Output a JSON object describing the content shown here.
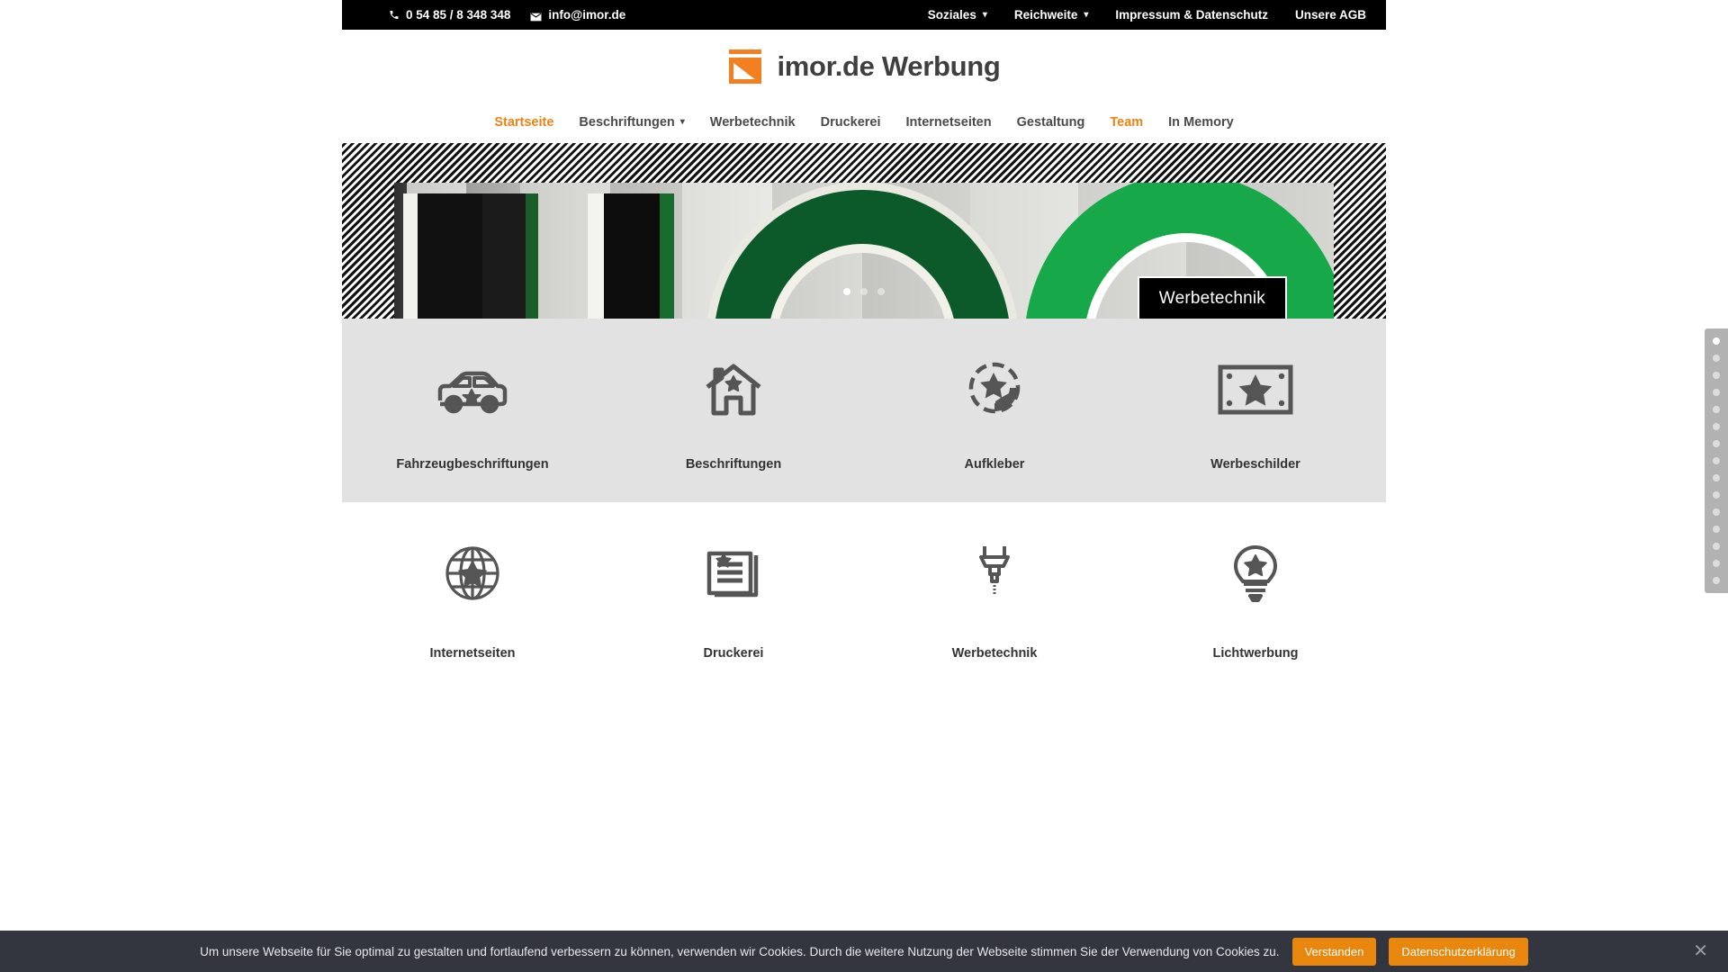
{
  "topbar": {
    "phone": "0 54 85 / 8 348 348",
    "email": "info@imor.de",
    "phone_icon": "phone-icon",
    "mail_icon": "mail-icon",
    "menu": [
      {
        "label": "Soziales",
        "has_dropdown": true
      },
      {
        "label": "Reichweite",
        "has_dropdown": true
      },
      {
        "label": "Impressum & Datenschutz",
        "has_dropdown": false
      },
      {
        "label": "Unsere AGB",
        "has_dropdown": false
      }
    ]
  },
  "brand": {
    "name": "imor.de Werbung",
    "mark_icon": "imor-logo-mark",
    "mark_color": "#f28020",
    "text_color": "#3f3f3f"
  },
  "mainnav": {
    "items": [
      {
        "label": "Startseite",
        "active": true,
        "has_dropdown": false
      },
      {
        "label": "Beschriftungen",
        "active": false,
        "has_dropdown": true
      },
      {
        "label": "Werbetechnik",
        "active": false,
        "has_dropdown": false
      },
      {
        "label": "Druckerei",
        "active": false,
        "has_dropdown": false
      },
      {
        "label": "Internetseiten",
        "active": false,
        "has_dropdown": false
      },
      {
        "label": "Gestaltung",
        "active": false,
        "has_dropdown": false
      },
      {
        "label": "Team",
        "active": true,
        "has_dropdown": false
      },
      {
        "label": "In Memory",
        "active": false,
        "has_dropdown": false
      }
    ],
    "accent_color": "#f08212"
  },
  "hero": {
    "caption": "Werbetechnik",
    "slides_total": 3,
    "active_slide": 1,
    "image_alt": "BIO Leuchtbuchstaben"
  },
  "services_row1": [
    {
      "label": "Fahrzeugbeschriftungen",
      "icon": "car-star-icon"
    },
    {
      "label": "Beschriftungen",
      "icon": "house-star-icon"
    },
    {
      "label": "Aufkleber",
      "icon": "sticker-star-icon"
    },
    {
      "label": "Werbeschilder",
      "icon": "sign-star-icon"
    }
  ],
  "services_row2": [
    {
      "label": "Internetseiten",
      "icon": "globe-star-icon"
    },
    {
      "label": "Druckerei",
      "icon": "document-star-icon"
    },
    {
      "label": "Werbetechnik",
      "icon": "engraver-icon"
    },
    {
      "label": "Lichtwerbung",
      "icon": "lightbulb-star-icon"
    }
  ],
  "dotnav": {
    "total": 15,
    "active": 1
  },
  "cookie": {
    "message": "Um unsere Webseite für Sie optimal zu gestalten und fortlaufend verbessern zu können, verwenden wir Cookies. Durch die weitere Nutzung der Webseite stimmen Sie der Verwendung von Cookies zu.",
    "accept_label": "Verstanden",
    "privacy_label": "Datenschutzerklärung",
    "close_icon": "close-icon",
    "button_color": "#e8860d",
    "bar_color": "#33353f"
  }
}
